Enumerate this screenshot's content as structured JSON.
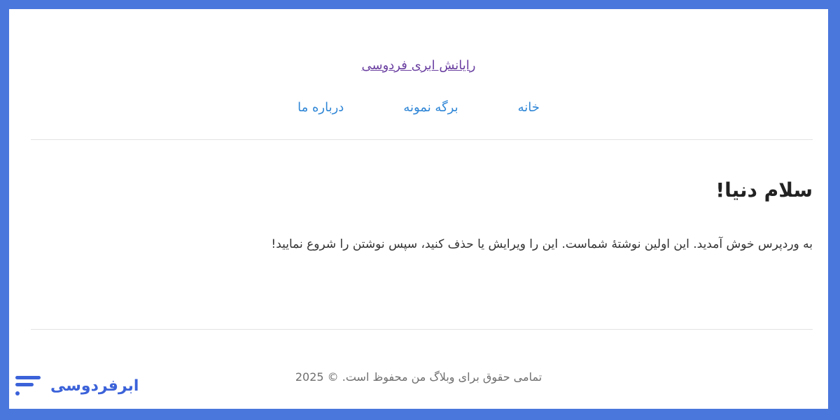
{
  "site": {
    "title": "رایانش ابری فردوسی"
  },
  "nav": {
    "items": [
      {
        "label": "خانه"
      },
      {
        "label": "برگه نمونه"
      },
      {
        "label": "درباره ما"
      }
    ]
  },
  "post": {
    "title": "سلام دنیا!",
    "body": "به وردپرس خوش آمدید. این اولین نوشتهٔ شماست. این را ویرایش یا حذف کنید، سپس نوشتن را شروع نمایید!"
  },
  "footer": {
    "text": "تمامی حقوق برای وبلاگ من محفوظ است. © 2025"
  },
  "watermark": {
    "logo_text": "ابرفردوسی",
    "logo_icon": "brand-mark-icon",
    "brand_color": "#3b62d9"
  },
  "colors": {
    "frame": "#4a77dc",
    "link": "#2f86d6",
    "visited_link": "#6a3fa0"
  }
}
